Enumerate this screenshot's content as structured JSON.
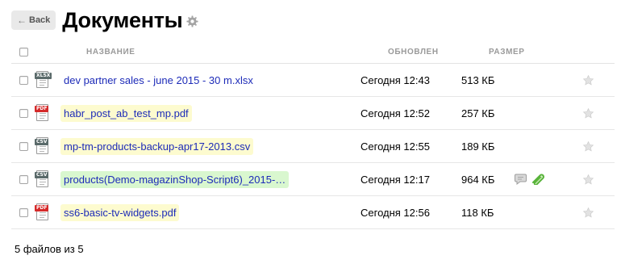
{
  "header": {
    "back_label": "Back",
    "title": "Документы"
  },
  "table": {
    "columns": {
      "name": "НАЗВАНИЕ",
      "updated": "ОБНОВЛЕН",
      "size": "РАЗМЕР"
    },
    "rows": [
      {
        "name": "dev partner sales - june 2015 - 30 m.xlsx",
        "updated": "Сегодня 12:43",
        "size": "513 КБ",
        "type": "xlsx",
        "type_tag": "XLSX",
        "highlight": "none",
        "extra_icons": []
      },
      {
        "name": "habr_post_ab_test_mp.pdf",
        "updated": "Сегодня 12:52",
        "size": "257 КБ",
        "type": "pdf",
        "type_tag": "PDF",
        "highlight": "yellow",
        "extra_icons": []
      },
      {
        "name": "mp-tm-products-backup-apr17-2013.csv",
        "updated": "Сегодня 12:55",
        "size": "189 КБ",
        "type": "csv",
        "type_tag": "CSV",
        "highlight": "yellow",
        "extra_icons": []
      },
      {
        "name": "products(Demo-magazinShop-Script6)_2015-…",
        "updated": "Сегодня 12:17",
        "size": "964 КБ",
        "type": "csv",
        "type_tag": "CSV",
        "highlight": "green",
        "extra_icons": [
          "comment-icon",
          "attachment-icon"
        ]
      },
      {
        "name": "ss6-basic-tv-widgets.pdf",
        "updated": "Сегодня 12:56",
        "size": "118 КБ",
        "type": "pdf",
        "type_tag": "PDF",
        "highlight": "yellow",
        "extra_icons": []
      }
    ]
  },
  "footer": {
    "count_text": "5 файлов из 5"
  },
  "colors": {
    "link": "#1d2bb8",
    "highlight_yellow": "#fdfbcf",
    "highlight_green": "#d9f7cf",
    "pdf_tag": "#d52a2a",
    "sheet_tag": "#5a6a6a"
  },
  "icons": {
    "back": "left-arrow-icon",
    "settings": "gear-icon",
    "favorite": "star-icon"
  }
}
